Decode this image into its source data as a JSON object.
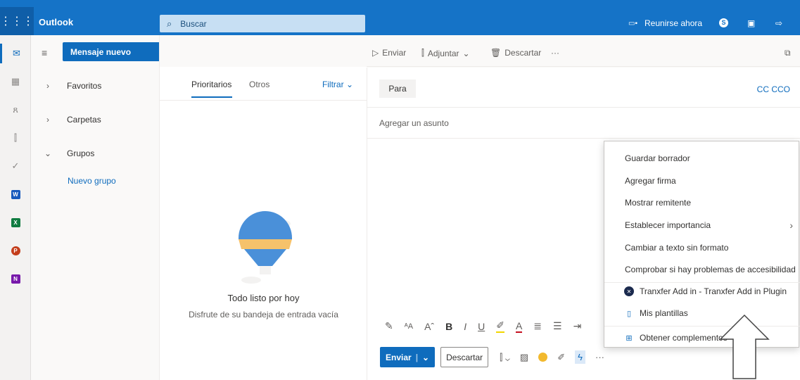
{
  "topbar": {
    "app_name": "Outlook",
    "search_placeholder": "Buscar",
    "meet_now": "Reunirse ahora"
  },
  "folders": {
    "new_mail": "Mensaje nuevo",
    "items": [
      {
        "label": "Favoritos"
      },
      {
        "label": "Carpetas"
      },
      {
        "label": "Grupos"
      }
    ],
    "new_group": "Nuevo grupo"
  },
  "message_list": {
    "tabs": [
      "Prioritarios",
      "Otros"
    ],
    "filter": "Filtrar",
    "empty_title": "Todo listo por hoy",
    "empty_subtitle": "Disfrute de su bandeja de entrada vacía"
  },
  "compose_toolbar": {
    "send": "Enviar",
    "attach": "Adjuntar",
    "discard": "Descartar",
    "more": "···"
  },
  "compose": {
    "to_button": "Para",
    "cc_bcc": "CC  CCO",
    "subject_placeholder": "Agregar un asunto",
    "send_button": "Enviar",
    "discard_button": "Descartar",
    "more": "···"
  },
  "menu": {
    "items": [
      {
        "label": "Guardar borrador"
      },
      {
        "label": "Agregar firma"
      },
      {
        "label": "Mostrar remitente"
      },
      {
        "label": "Establecer importancia"
      },
      {
        "label": "Cambiar a texto sin formato"
      },
      {
        "label": "Comprobar si hay problemas de accesibilidad"
      },
      {
        "label": "Tranxfer Add in - Tranxfer Add in Plugin"
      },
      {
        "label": "Mis plantillas"
      },
      {
        "label": "Obtener complementos"
      }
    ]
  },
  "colors": {
    "brand": "#0f6cbd",
    "topbar": "#1573c7"
  }
}
